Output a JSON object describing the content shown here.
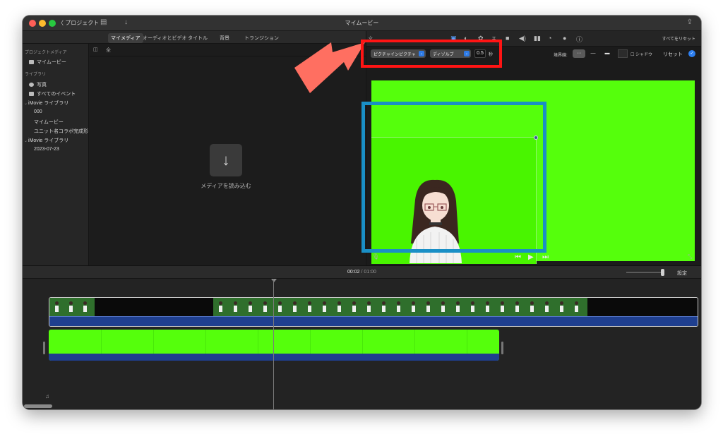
{
  "titlebar": {
    "projects_label": "〈 プロジェクト",
    "title": "マイムービー"
  },
  "browser_tabs": [
    {
      "label": "マイメディア",
      "active": true
    },
    {
      "label": "オーディオとビデオ",
      "active": false
    },
    {
      "label": "タイトル",
      "active": false
    },
    {
      "label": "背景",
      "active": false
    },
    {
      "label": "トランジション",
      "active": false
    }
  ],
  "sidebar": {
    "project_media_header": "プロジェクトメディア",
    "project_item": "マイムービー",
    "library_header": "ライブラリ",
    "items": [
      {
        "label": "写真",
        "icon": "photos-icon"
      },
      {
        "label": "すべてのイベント",
        "icon": "all-events-icon"
      }
    ],
    "libraries": [
      {
        "name": "iMovie ライブラリ",
        "events": [
          "000",
          "マイムービー",
          "ユニット名コラボ完成形"
        ]
      },
      {
        "name": "iMovie ライブラリ",
        "events": [
          "2023-07-23"
        ]
      }
    ]
  },
  "media_browser": {
    "all_clips_label": "全",
    "import_label": "メディアを読み込む"
  },
  "viewer": {
    "reset_all_label": "すべてをリセット",
    "overlay_style": "ピクチャインピクチャ",
    "transition_style": "ディゾルブ",
    "duration_value": "0.5",
    "duration_unit": "秒",
    "border_label": "境界線:",
    "shadow_label": "シャドウ",
    "reset_label": "リセット",
    "preview_color": "#55ff0c"
  },
  "timeline": {
    "current_time": "00:02",
    "separator": "/",
    "total_time": "01:00",
    "settings_label": "設定"
  },
  "annotations": {
    "red_box_color": "#ff1414",
    "blue_box_color": "#1a8fc6",
    "arrow_color": "#ff6f61"
  }
}
